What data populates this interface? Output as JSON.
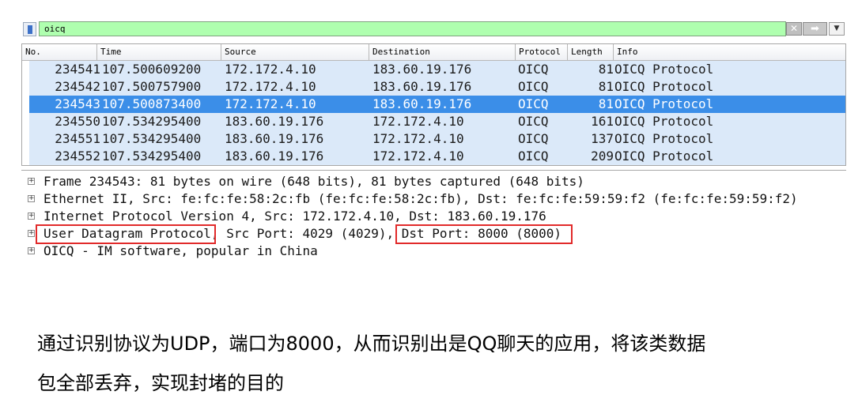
{
  "filter": {
    "value": "oicq",
    "clear_glyph": "✕",
    "apply_glyph": "➡",
    "dropdown_glyph": "▼"
  },
  "columns": [
    "No.",
    "Time",
    "Source",
    "Destination",
    "Protocol",
    "Length",
    "Info"
  ],
  "packets": [
    {
      "no": "234541",
      "time": "107.500609200",
      "source": "172.172.4.10",
      "destination": "183.60.19.176",
      "protocol": "OICQ",
      "length": "81",
      "info": "OICQ Protocol"
    },
    {
      "no": "234542",
      "time": "107.500757900",
      "source": "172.172.4.10",
      "destination": "183.60.19.176",
      "protocol": "OICQ",
      "length": "81",
      "info": "OICQ Protocol"
    },
    {
      "no": "234543",
      "time": "107.500873400",
      "source": "172.172.4.10",
      "destination": "183.60.19.176",
      "protocol": "OICQ",
      "length": "81",
      "info": "OICQ Protocol",
      "selected": true
    },
    {
      "no": "234550",
      "time": "107.534295400",
      "source": "183.60.19.176",
      "destination": "172.172.4.10",
      "protocol": "OICQ",
      "length": "161",
      "info": "OICQ Protocol"
    },
    {
      "no": "234551",
      "time": "107.534295400",
      "source": "183.60.19.176",
      "destination": "172.172.4.10",
      "protocol": "OICQ",
      "length": "137",
      "info": "OICQ Protocol"
    },
    {
      "no": "234552",
      "time": "107.534295400",
      "source": "183.60.19.176",
      "destination": "172.172.4.10",
      "protocol": "OICQ",
      "length": "209",
      "info": "OICQ Protocol"
    }
  ],
  "details": {
    "frame": "Frame 234543: 81 bytes on wire (648 bits), 81 bytes captured (648 bits)",
    "ethernet": "Ethernet II, Src: fe:fc:fe:58:2c:fb (fe:fc:fe:58:2c:fb), Dst: fe:fc:fe:59:59:f2 (fe:fc:fe:59:59:f2)",
    "ip": "Internet Protocol Version 4, Src: 172.172.4.10, Dst: 183.60.19.176",
    "udp": "User Datagram Protocol, Src Port: 4029 (4029), Dst Port: 8000 (8000)",
    "oicq": "OICQ - IM software, popular in China"
  },
  "expander_glyph": "+",
  "caption": {
    "line1": "通过识别协议为UDP，端口为8000，从而识别出是QQ聊天的应用，将该类数据",
    "line2": "包全部丢弃，实现封堵的目的"
  },
  "colors": {
    "filter_valid": "#afffaf",
    "row_bg": "#dbe9f9",
    "row_selected": "#3b8ee8",
    "highlight_box": "#e12a2a"
  }
}
